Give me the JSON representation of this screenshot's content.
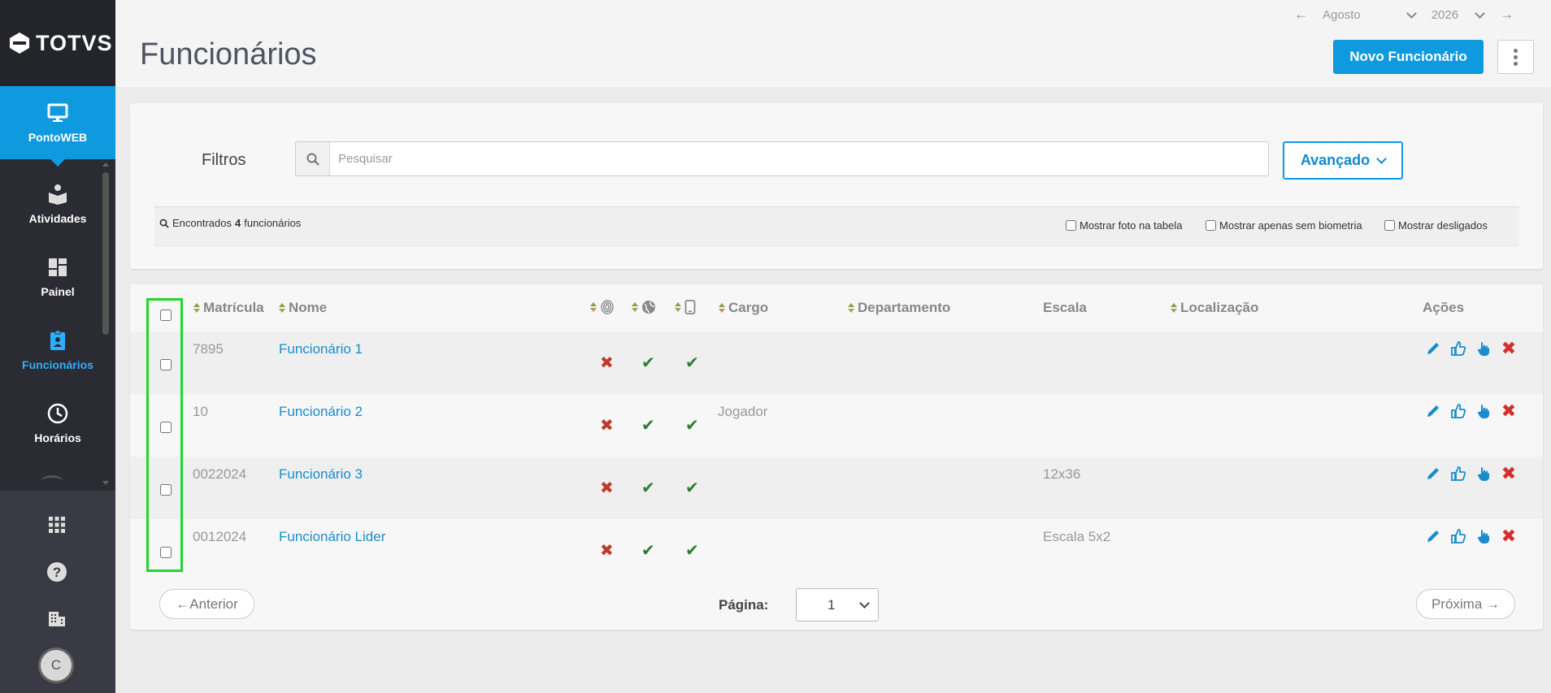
{
  "app": {
    "brand": "TOTVS"
  },
  "sidebar": {
    "items": [
      {
        "label": "PontoWEB",
        "icon": "monitor-icon"
      },
      {
        "label": "Atividades",
        "icon": "book-reader-icon"
      },
      {
        "label": "Painel",
        "icon": "dashboard-icon"
      },
      {
        "label": "Funcionários",
        "icon": "id-badge-icon"
      },
      {
        "label": "Horários",
        "icon": "clock-icon"
      }
    ],
    "bottom": [
      "apps-grid-icon",
      "help-icon",
      "building-icon"
    ],
    "avatar_initial": "C"
  },
  "header": {
    "title": "Funcionários",
    "month": "Agosto",
    "year": "2026",
    "new_button": "Novo Funcionário"
  },
  "filters": {
    "label": "Filtros",
    "search_placeholder": "Pesquisar",
    "advanced_button": "Avançado",
    "found_prefix": "Encontrados",
    "found_count": "4",
    "found_suffix": "funcionários",
    "options": [
      "Mostrar foto na tabela",
      "Mostrar apenas sem biometria",
      "Mostrar desligados"
    ]
  },
  "table": {
    "headers": {
      "matricula": "Matrícula",
      "nome": "Nome",
      "cargo": "Cargo",
      "departamento": "Departamento",
      "escala": "Escala",
      "localizacao": "Localização",
      "acoes": "Ações"
    },
    "rows": [
      {
        "matricula": "7895",
        "nome": "Funcionário 1",
        "cargo": "",
        "departamento": "",
        "escala": "",
        "localizacao": "",
        "biometria": false,
        "web": true,
        "mobile": true
      },
      {
        "matricula": "10",
        "nome": "Funcionário 2",
        "cargo": "Jogador",
        "departamento": "",
        "escala": "",
        "localizacao": "",
        "biometria": false,
        "web": true,
        "mobile": true
      },
      {
        "matricula": "0022024",
        "nome": "Funcionário 3",
        "cargo": "",
        "departamento": "",
        "escala": "12x36",
        "localizacao": "",
        "biometria": false,
        "web": true,
        "mobile": true
      },
      {
        "matricula": "0012024",
        "nome": "Funcionário Lider",
        "cargo": "",
        "departamento": "",
        "escala": "Escala 5x2",
        "localizacao": "",
        "biometria": false,
        "web": true,
        "mobile": true
      }
    ]
  },
  "pagination": {
    "prev": "←Anterior",
    "next": "Próxima →",
    "page_label": "Página:",
    "page_value": "1"
  },
  "colors": {
    "accent": "#0f9ae0",
    "sidebar": "#2b2b33",
    "highlight": "#22d62a"
  }
}
